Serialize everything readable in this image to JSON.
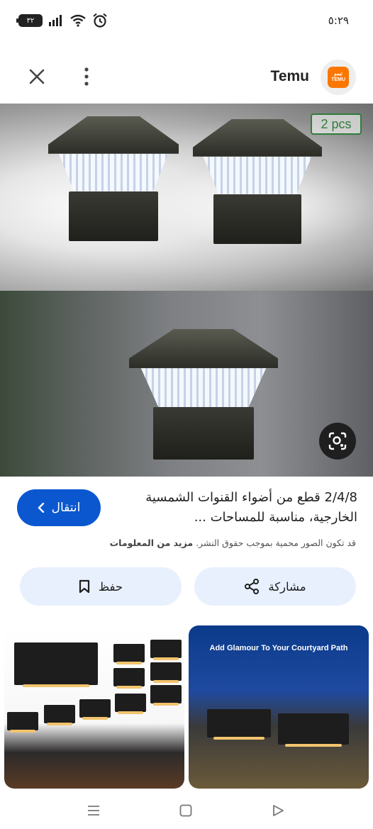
{
  "status_bar": {
    "time": "٥:٢٩",
    "battery": "٣٢"
  },
  "header": {
    "site_name": "Temu",
    "logo_lines": [
      "تيمو",
      "TEMU"
    ]
  },
  "hero": {
    "badge": "2 pcs"
  },
  "product": {
    "title": "2/4/8 قطع من أضواء القنوات الشمسية الخارجية، مناسبة للمساحات ...",
    "visit_label": "انتقال",
    "copyright_text": "قد تكون الصور محمية بموجب حقوق النشر.",
    "more_info": "مزيد من المعلومات"
  },
  "actions": {
    "save_label": "حفظ",
    "share_label": "مشاركة"
  },
  "related": {
    "right_caption": "Add Glamour To Your Courtyard Path"
  }
}
